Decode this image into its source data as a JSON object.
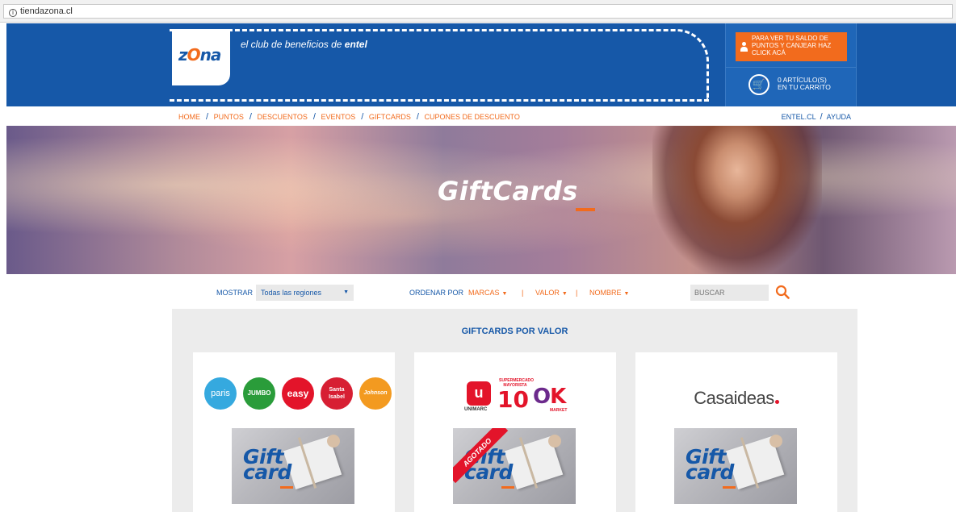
{
  "browser": {
    "url": "tiendazona.cl"
  },
  "header": {
    "logo_prefix": "z",
    "logo_o": "O",
    "logo_suffix": "na",
    "tagline_prefix": "el club de beneficios de ",
    "tagline_brand": "entel",
    "points_button": "PARA VER TU SALDO DE PUNTOS Y CANJEAR HAZ CLICK ACÁ",
    "cart_line1": "0 ARTÍCULO(S)",
    "cart_line2": "EN TU CARRITO"
  },
  "nav": {
    "items": [
      "HOME",
      "PUNTOS",
      "DESCUENTOS",
      "EVENTOS",
      "GIFTCARDS",
      "CUPONES DE DESCUENTO"
    ],
    "separator": "/",
    "right_items": [
      "ENTEL.CL",
      "AYUDA"
    ]
  },
  "hero": {
    "title": "GiftCards"
  },
  "filters": {
    "show_label": "MOSTRAR",
    "region_value": "Todas las regiones",
    "order_label": "ORDENAR POR",
    "sort_brands": "MARCAS",
    "sort_value": "VALOR",
    "sort_name": "NOMBRE",
    "divider": "|",
    "search_placeholder": "BUSCAR"
  },
  "panel": {
    "title": "GIFTCARDS POR VALOR",
    "cards": [
      {
        "brands": [
          "paris",
          "JUMBO",
          "easy",
          "Santa Isabel",
          "Johnson"
        ],
        "gift_word1": "Gift",
        "gift_word2": "card",
        "badge": ""
      },
      {
        "brands": [
          "UNIMARC",
          "SUPERMERCADO MAYORISTA",
          "10",
          "OK",
          "MARKET"
        ],
        "gift_word1": "Gift",
        "gift_word2": "card",
        "badge": "AGOTADO"
      },
      {
        "brands": [
          "Casaideas"
        ],
        "gift_word1": "Gift",
        "gift_word2": "card",
        "badge": ""
      }
    ]
  },
  "colors": {
    "brand_blue": "#1658a8",
    "accent_orange": "#f26b1d",
    "red": "#e3142a"
  }
}
